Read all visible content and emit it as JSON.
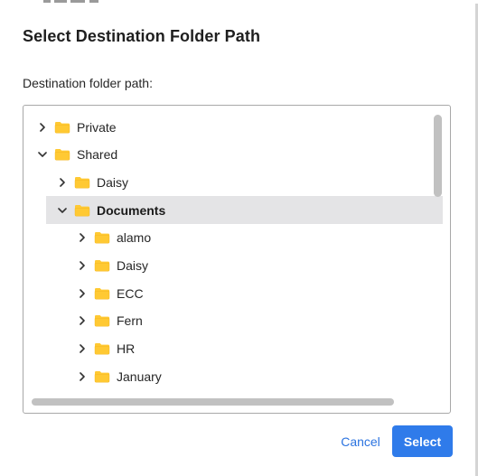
{
  "dialog": {
    "title": "Select Destination Folder Path",
    "field_label": "Destination folder path:"
  },
  "tree": {
    "items": [
      {
        "label": "Private",
        "depth": 0,
        "expanded": false,
        "selected": false
      },
      {
        "label": "Shared",
        "depth": 0,
        "expanded": true,
        "selected": false
      },
      {
        "label": "Daisy",
        "depth": 1,
        "expanded": false,
        "selected": false
      },
      {
        "label": "Documents",
        "depth": 1,
        "expanded": true,
        "selected": true
      },
      {
        "label": "alamo",
        "depth": 2,
        "expanded": false,
        "selected": false
      },
      {
        "label": "Daisy",
        "depth": 2,
        "expanded": false,
        "selected": false
      },
      {
        "label": "ECC",
        "depth": 2,
        "expanded": false,
        "selected": false
      },
      {
        "label": "Fern",
        "depth": 2,
        "expanded": false,
        "selected": false
      },
      {
        "label": "HR",
        "depth": 2,
        "expanded": false,
        "selected": false
      },
      {
        "label": "January",
        "depth": 2,
        "expanded": false,
        "selected": false
      }
    ]
  },
  "buttons": {
    "cancel_label": "Cancel",
    "select_label": "Select"
  },
  "icons": {
    "folder": "folder-icon",
    "collapsed": "chevron-right-icon",
    "expanded": "chevron-down-icon"
  },
  "colors": {
    "folder": "#ffc933",
    "accent": "#2f7bea",
    "selected_row": "#e4e4e6"
  }
}
